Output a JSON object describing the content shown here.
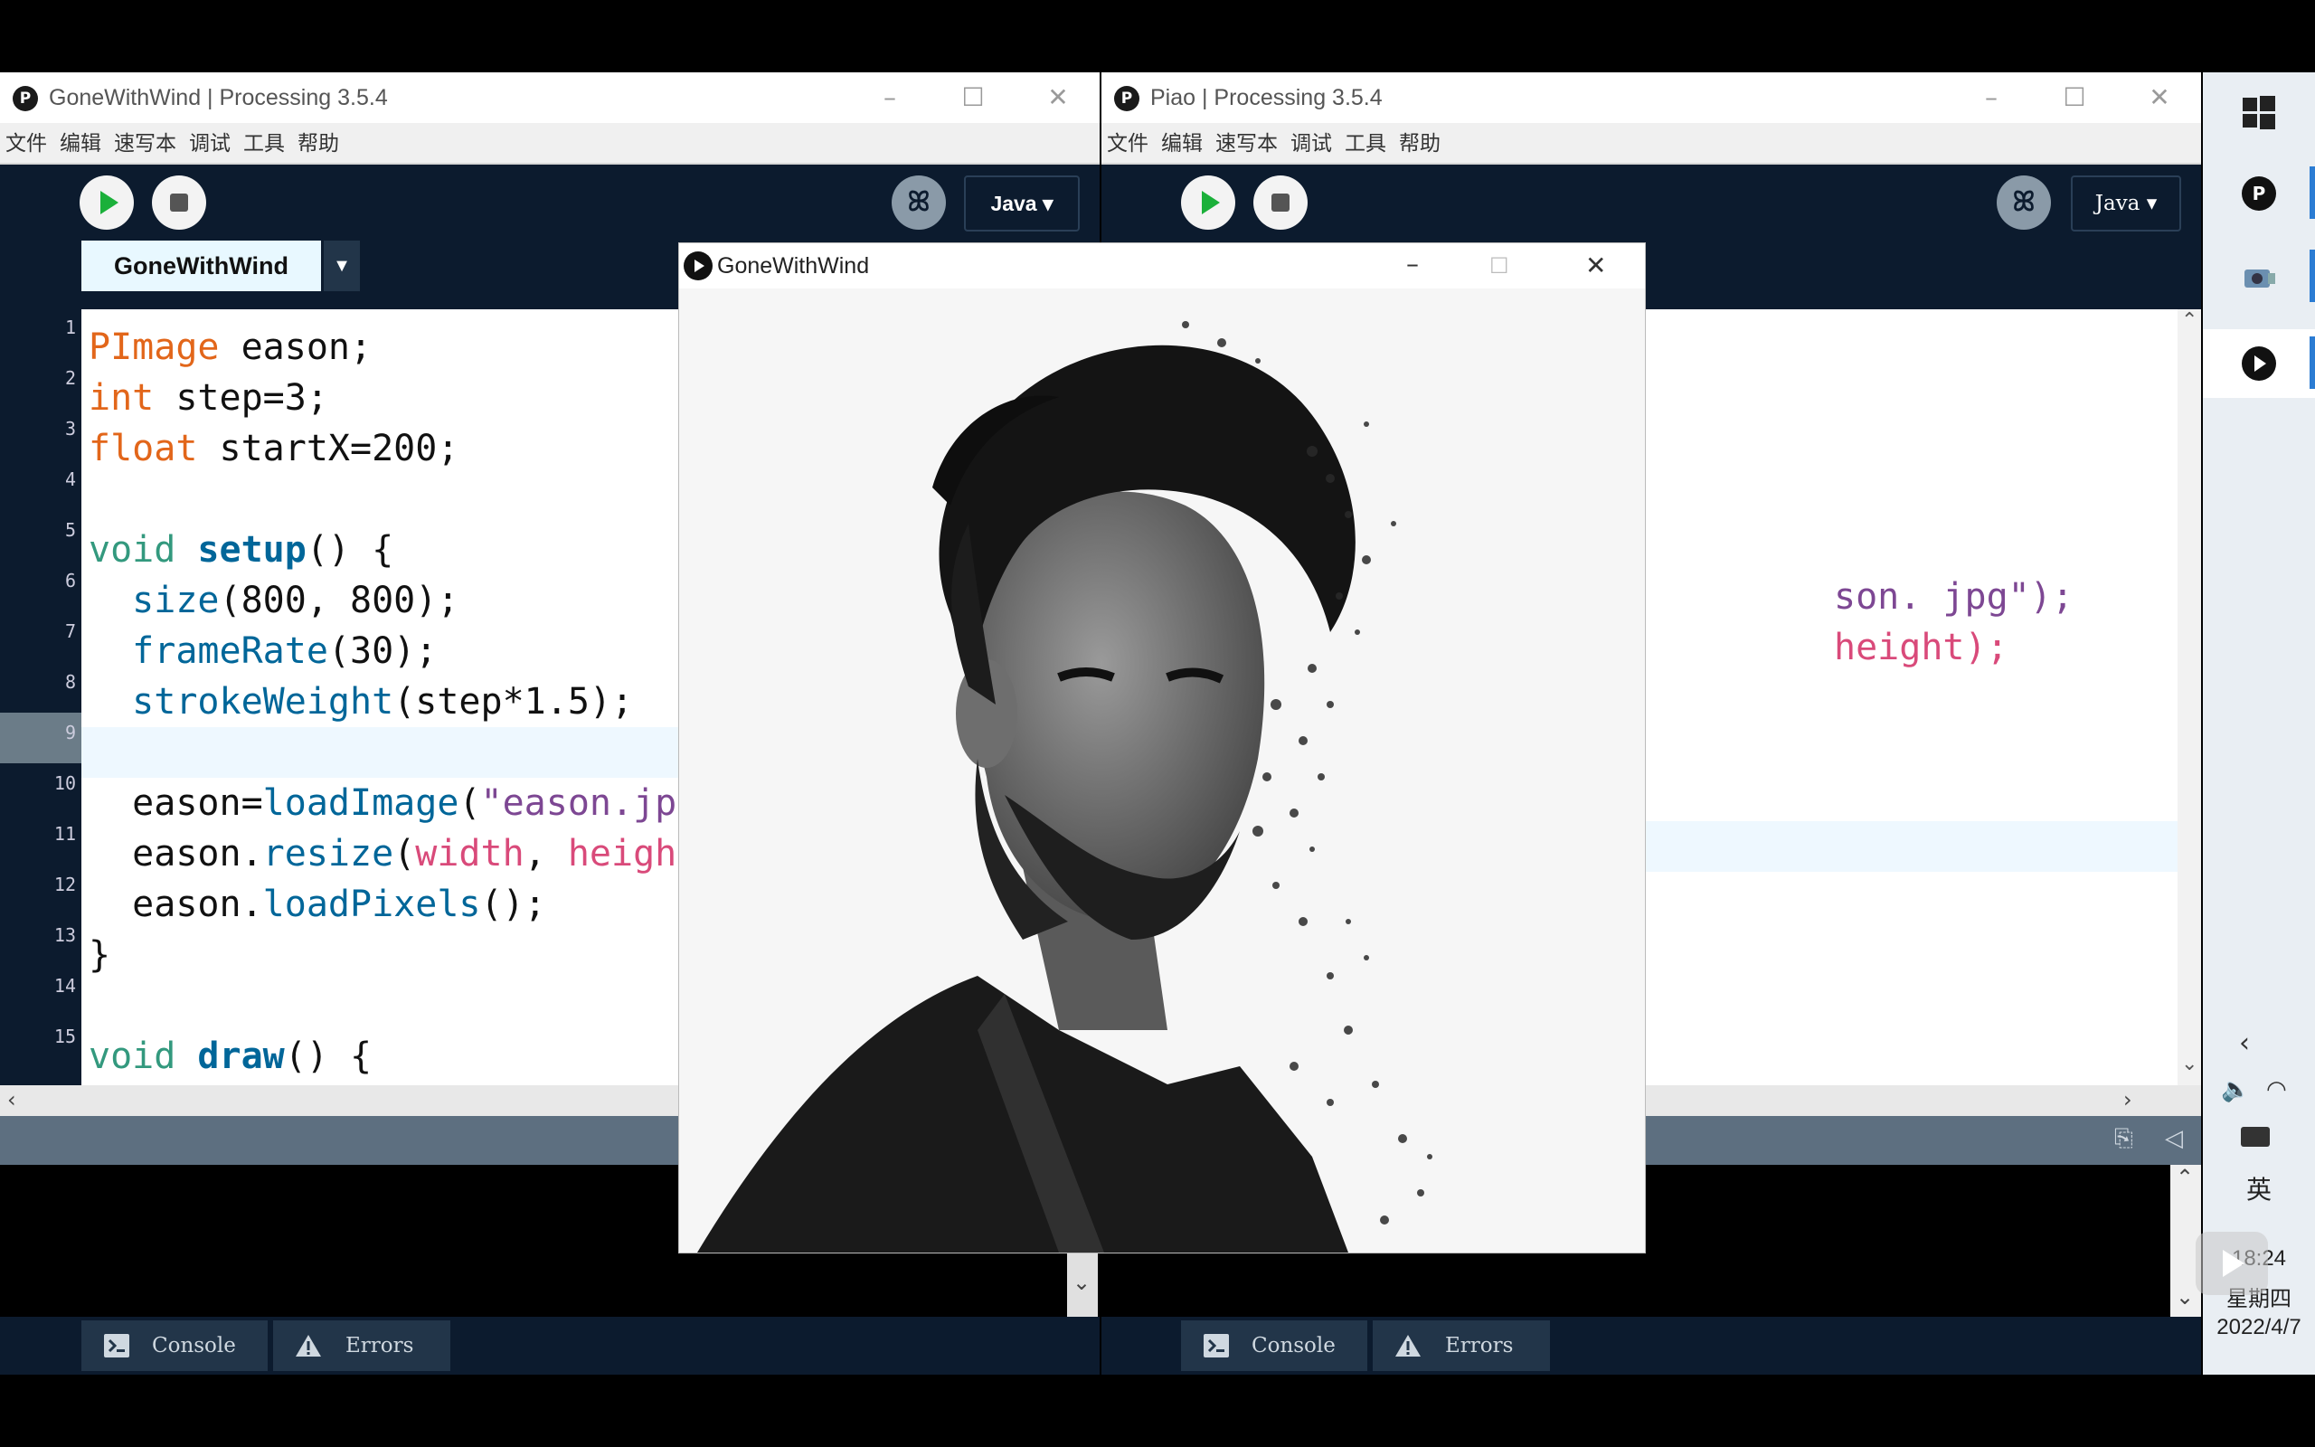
{
  "left_window": {
    "title": "GoneWithWind | Processing 3.5.4",
    "menu": [
      "文件",
      "编辑",
      "速写本",
      "调试",
      "工具",
      "帮助"
    ],
    "mode_label": "Java ▾",
    "tab_name": "GoneWithWind",
    "line_numbers": [
      "1",
      "2",
      "3",
      "4",
      "5",
      "6",
      "7",
      "8",
      "9",
      "10",
      "11",
      "12",
      "13",
      "14",
      "15"
    ],
    "bottom_tabs": {
      "console": "Console",
      "errors": "Errors"
    }
  },
  "right_window": {
    "title": "Piao | Processing 3.5.4",
    "menu": [
      "文件",
      "编辑",
      "速写本",
      "调试",
      "工具",
      "帮助"
    ],
    "mode_label": "Java ▾",
    "code_visible": [
      "son. jpg\");",
      "height);"
    ],
    "bottom_tabs": {
      "console": "Console",
      "errors": "Errors"
    }
  },
  "sketch_window": {
    "title": "GoneWithWind"
  },
  "taskbar": {
    "ime": "英",
    "time": "18:24",
    "weekday": "星期四",
    "date": "2022/4/7"
  },
  "colors": {
    "ide_bg": "#0c1b2e",
    "play_green": "#1bb03a",
    "type_orange": "#e2661a",
    "keyword_teal": "#33997e",
    "function_blue": "#006699",
    "string_purple": "#7d4793",
    "variable_pink": "#d94a7a"
  }
}
